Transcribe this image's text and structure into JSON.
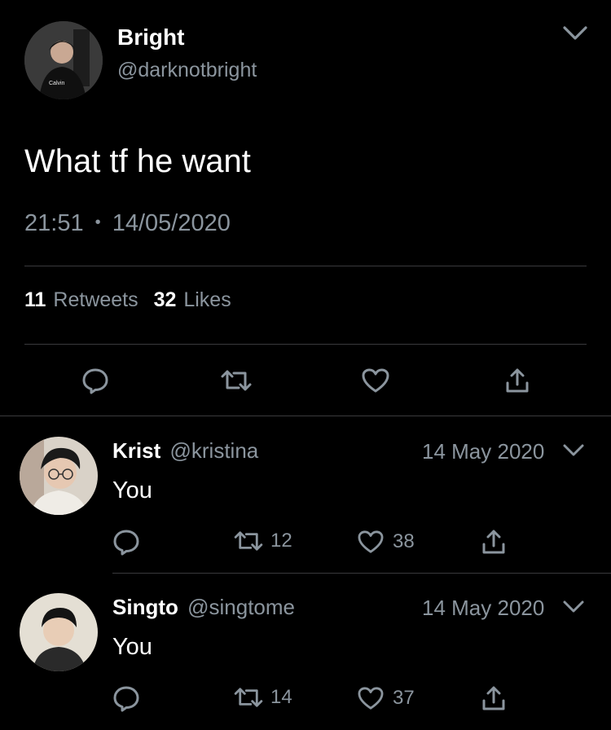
{
  "colors": {
    "background": "#000000",
    "text": "#ffffff",
    "secondary": "#8b959e",
    "divider": "#3a3a3c"
  },
  "main_tweet": {
    "name": "Bright",
    "handle": "@darknotbright",
    "avatar_text": "Calvin",
    "text": "What tf he want",
    "time": "21:51",
    "separator": "•",
    "date": "14/05/2020",
    "retweets_count": "11",
    "retweets_label": "Retweets",
    "likes_count": "32",
    "likes_label": "Likes",
    "menu_icon": "chevron-down-icon",
    "actions": [
      "reply-icon",
      "retweet-icon",
      "like-icon",
      "share-icon"
    ]
  },
  "replies": [
    {
      "name": "Krist",
      "handle": "@kristina",
      "date": "14 May 2020",
      "text": "You",
      "retweets": "12",
      "likes": "38"
    },
    {
      "name": "Singto",
      "handle": "@singtome",
      "date": "14 May 2020",
      "text": "You",
      "retweets": "14",
      "likes": "37"
    }
  ]
}
